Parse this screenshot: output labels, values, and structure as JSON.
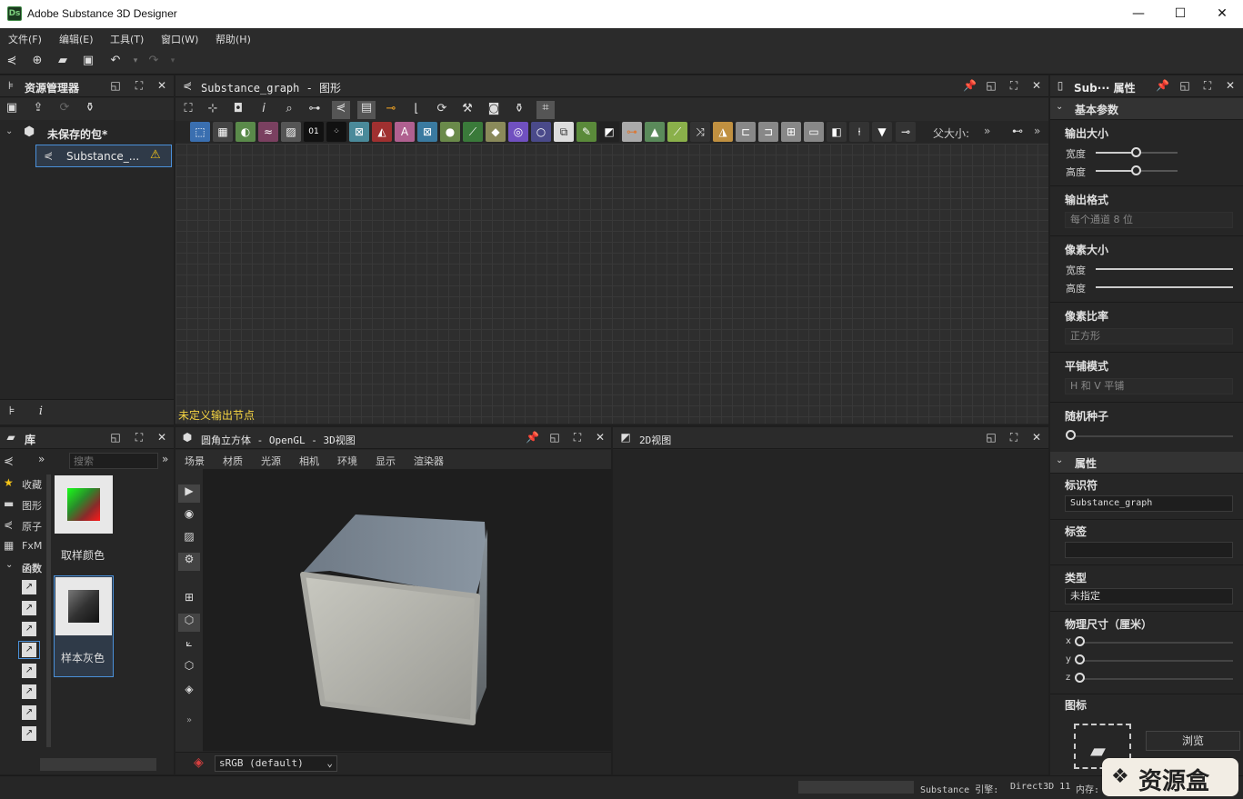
{
  "app": {
    "title": "Adobe Substance 3D Designer",
    "logo": "Ds"
  },
  "window_controls": {
    "minimize": "—",
    "maximize": "☐",
    "close": "✕"
  },
  "menu": [
    "文件(F)",
    "编辑(E)",
    "工具(T)",
    "窗口(W)",
    "帮助(H)"
  ],
  "explorer": {
    "title": "资源管理器",
    "package": "未保存的包*",
    "graph_item": "Substance_..."
  },
  "graph": {
    "title": "Substance_graph - 图形",
    "parent_size_label": "父大小:",
    "status": "未定义输出节点"
  },
  "library": {
    "title": "库",
    "search_placeholder": "搜索",
    "categories": [
      "收藏",
      "图形",
      "原子",
      "FxM",
      "函数"
    ],
    "items": [
      "取样颜色",
      "样本灰色"
    ]
  },
  "view3d": {
    "title": "圆角立方体 - OpenGL - 3D视图",
    "menu": [
      "场景",
      "材质",
      "光源",
      "相机",
      "环境",
      "显示",
      "渲染器"
    ],
    "colorspace": "sRGB (default)"
  },
  "view2d": {
    "title": "2D视图"
  },
  "properties": {
    "title": "Sub··· 属性",
    "section_basic": "基本参数",
    "output_size": "输出大小",
    "width": "宽度",
    "height": "高度",
    "output_format": "输出格式",
    "output_format_value": "每个通道 8 位",
    "pixel_size": "像素大小",
    "pixel_width": "宽度",
    "pixel_height": "高度",
    "pixel_ratio": "像素比率",
    "pixel_ratio_value": "正方形",
    "tiling_mode": "平铺模式",
    "tiling_mode_value": "H 和 V 平铺",
    "random_seed": "随机种子",
    "section_attrs": "属性",
    "identifier": "标识符",
    "identifier_value": "Substance_graph",
    "label": "标签",
    "label_value": "",
    "type": "类型",
    "type_value": "未指定",
    "physical_size": "物理尺寸（厘米）",
    "x": "x",
    "y": "y",
    "z": "z",
    "icon": "图标",
    "browse": "浏览"
  },
  "status": {
    "engine": "Substance 引擎:",
    "engine_value": "Direct3D 11",
    "memory": "内存:"
  },
  "watermark": "资源盒"
}
